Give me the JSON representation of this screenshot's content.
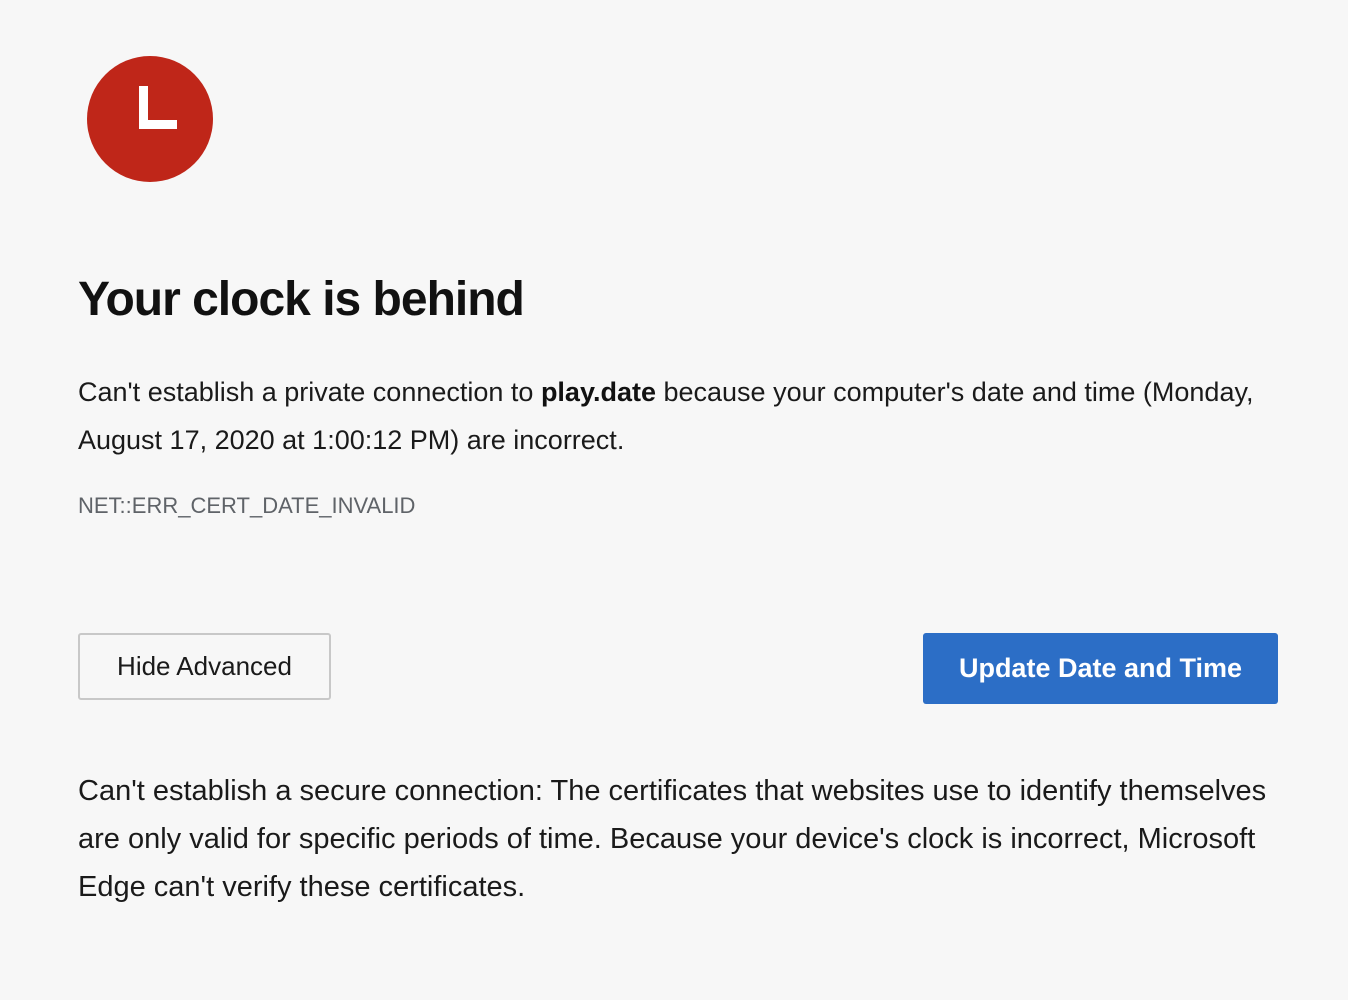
{
  "icon": {
    "name": "clock-error-icon",
    "color": "#bf2619"
  },
  "title": "Your clock is behind",
  "message": {
    "before_host": "Can't establish a private connection to ",
    "host": "play.date",
    "after_host": " because your computer's date and time (Monday, August 17, 2020 at 1:00:12 PM) are incorrect."
  },
  "error_code": "NET::ERR_CERT_DATE_INVALID",
  "buttons": {
    "hide_advanced": "Hide Advanced",
    "update_date_time": "Update Date and Time"
  },
  "details": "Can't establish a secure connection: The certificates that websites use to identify themselves are only valid for specific periods of time. Because your device's clock is incorrect, Microsoft Edge can't verify these certificates.",
  "colors": {
    "background": "#f7f7f7",
    "primary_button": "#2c6ec6",
    "error_code_text": "#5f6368"
  }
}
